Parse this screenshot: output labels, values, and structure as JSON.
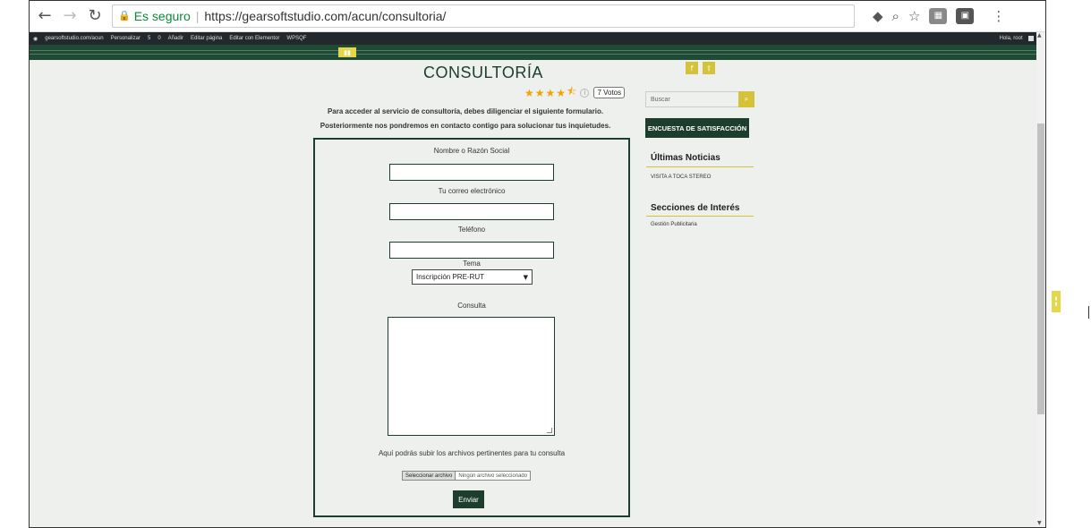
{
  "browser": {
    "secure_label": "Es seguro",
    "url": "https://gearsoftstudio.com/acun/consultoria/"
  },
  "adminbar": {
    "site": "gearsoftstudio.com/acun",
    "items": [
      "Personalizar",
      "5",
      "0",
      "Añadir",
      "Editar página",
      "Editar con Elementor",
      "WPSQF"
    ],
    "greeting": "Hola, root"
  },
  "page": {
    "title": "CONSULTORÍA",
    "rating": {
      "stars": 4.5,
      "votes_label": "7 Votos"
    },
    "intro_line1": "Para acceder al servicio de consultoría, debes diligenciar el siguiente formulario.",
    "intro_line2": "Posteriormente nos pondremos en contacto contigo para solucionar tus inquietudes."
  },
  "form": {
    "name_label": "Nombre o Razón Social",
    "email_label": "Tu correo electrónico",
    "phone_label": "Teléfono",
    "topic_label": "Tema",
    "topic_value": "Inscripción PRE-RUT",
    "query_label": "Consulta",
    "upload_label": "Aquí podrás subir los archivos pertinentes para tu consulta",
    "file_button": "Seleccionar archivo",
    "file_status": "Ningún archivo seleccionado",
    "submit_label": "Enviar"
  },
  "sidebar": {
    "search_placeholder": "Buscar",
    "survey_button": "ENCUESTA DE SATISFACCIÓN",
    "news_title": "Últimas Noticias",
    "news_items": [
      "VISITA A TOCA STEREO"
    ],
    "sections_title": "Secciones de Interés",
    "sections_items": [
      "Gestión Publicitaria"
    ]
  },
  "colors": {
    "primary": "#1d3e2e",
    "accent": "#d6c13a",
    "background": "#eef0ee"
  }
}
